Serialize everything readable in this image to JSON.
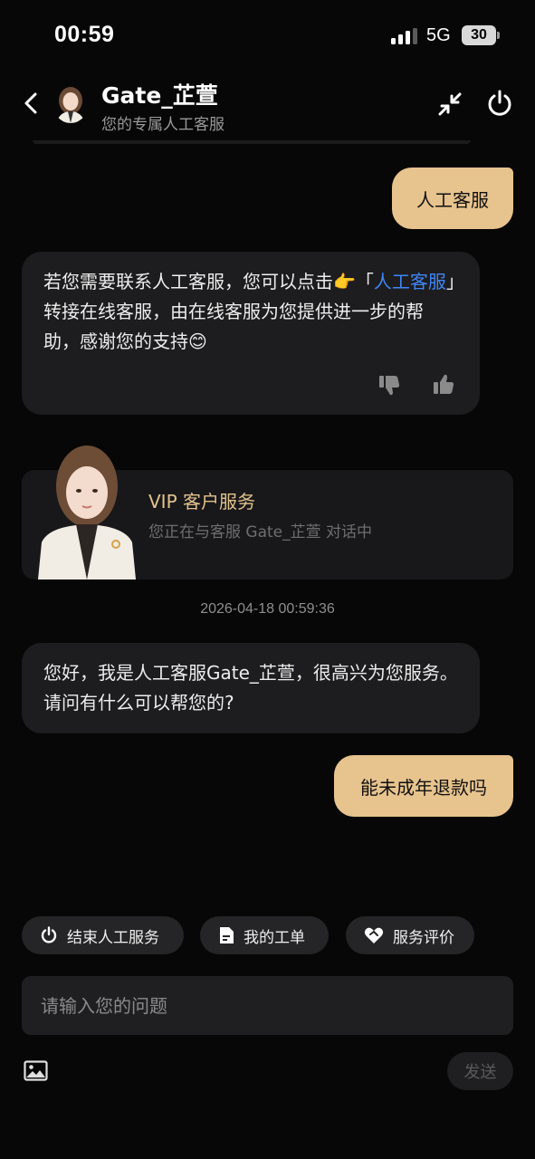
{
  "status_bar": {
    "time": "00:59",
    "network": "5G",
    "battery": "30"
  },
  "header": {
    "title": "Gate_芷萱",
    "subtitle": "您的专属人工客服"
  },
  "messages": {
    "user_1": "人工客服",
    "bot_1": {
      "text_a": "若您需要联系人工客服，您可以点击👉「",
      "link": "人工客服",
      "text_b": "」转接在线客服，由在线客服为您提供进一步的帮助，感谢您的支持😊"
    },
    "vip": {
      "title": "VIP 客户服务",
      "subtitle": "您正在与客服 Gate_芷萱 对话中"
    },
    "timestamp": "2026-04-18 00:59:36",
    "bot_2": "您好，我是人工客服Gate_芷萱，很高兴为您服务。请问有什么可以帮您的?",
    "user_2": "能未成年退款吗"
  },
  "quick_actions": [
    {
      "label": "结束人工服务",
      "icon": "power-icon"
    },
    {
      "label": "我的工单",
      "icon": "document-icon"
    },
    {
      "label": "服务评价",
      "icon": "heart-handshake-icon"
    }
  ],
  "composer": {
    "placeholder": "请输入您的问题",
    "send_label": "发送"
  },
  "colors": {
    "accent_gold": "#e7c38e",
    "link_blue": "#3f86f5",
    "background": "#070707"
  }
}
